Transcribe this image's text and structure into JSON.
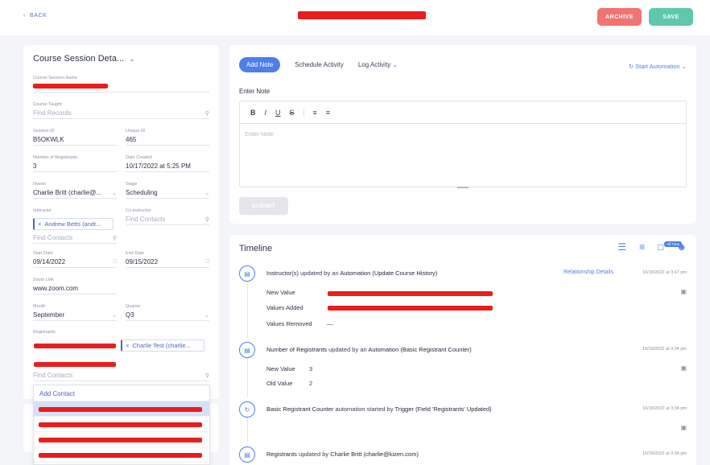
{
  "header": {
    "back_label": "BACK",
    "archive_label": "ARCHIVE",
    "save_label": "SAVE",
    "colors": {
      "archive": "#f07470",
      "save": "#5fc7ad",
      "accent": "#4d7fea"
    }
  },
  "left_panel": {
    "title": "Course Session Deta...",
    "fields": {
      "session_name": {
        "label": "Course Session Name"
      },
      "course_taught": {
        "label": "Course Taught",
        "placeholder": "Find Records"
      },
      "session_id": {
        "label": "Session ID",
        "value": "B5OKWLK"
      },
      "unique_id": {
        "label": "Unique ID",
        "value": "465"
      },
      "num_registrants": {
        "label": "Number of Registrants",
        "value": "3"
      },
      "date_created": {
        "label": "Date Created",
        "value": "10/17/2022 at 5:25 PM"
      },
      "owner": {
        "label": "Owner",
        "value": "Charlie Britt (charlie@..."
      },
      "stage": {
        "label": "Stage",
        "value": "Scheduling"
      },
      "instructor": {
        "label": "Instructor",
        "chip": "Andrew Betts (andr...",
        "placeholder": "Find Contacts"
      },
      "co_instructor": {
        "label": "Co-instructor",
        "placeholder": "Find Contacts"
      },
      "start_date": {
        "label": "Start Date",
        "value": "09/14/2022"
      },
      "end_date": {
        "label": "End Date",
        "value": "09/15/2022"
      },
      "zoom_link": {
        "label": "Zoom Link",
        "value": "www.zoom.com"
      },
      "month": {
        "label": "Month",
        "value": "September"
      },
      "quarter": {
        "label": "Quarter",
        "value": "Q3"
      },
      "registrants": {
        "label": "Registrants",
        "chip": "Charlie Test (charlie...",
        "placeholder": "Find Contacts"
      }
    },
    "dropdown": {
      "add_label": "Add Contact"
    }
  },
  "note_panel": {
    "tabs": [
      "Add Note",
      "Schedule Activity",
      "Log Activity"
    ],
    "start_automation": "Start Automation",
    "enter_note_label": "Enter Note",
    "editor_placeholder": "Enter Note",
    "toolbar": {
      "bold": "B",
      "italic": "I",
      "underline": "U",
      "strike": "S"
    },
    "submit_label": "SUBMIT"
  },
  "timeline": {
    "title": "Timeline",
    "filter_badge": "All Time",
    "events": [
      {
        "subject": "Instructor(s)",
        "verb": " updated by an ",
        "actor": "Automation (Update Course History)",
        "link": "Relationship Details",
        "time": "10/19/2022 at 3:47 pm",
        "rows": [
          {
            "key": "New Value",
            "value": ""
          },
          {
            "key": "Values Added",
            "value": ""
          },
          {
            "key": "Values Removed",
            "value": "—"
          }
        ]
      },
      {
        "subject": "Number of Registrants",
        "verb": " updated by an ",
        "actor": "Automation (Basic Registrant Counter)",
        "time": "10/19/2022 at 3:34 pm",
        "rows": [
          {
            "key": "New Value",
            "value": "3"
          },
          {
            "key": "Old Value",
            "value": "2"
          }
        ]
      },
      {
        "subject": "Basic Registrant Counter",
        "verb": " automation started by ",
        "actor": "Trigger (Field 'Registrants' Updated)",
        "time": "10/19/2022 at 3:34 pm"
      },
      {
        "subject": "Registrants",
        "verb": " updated by ",
        "actor": "Charlie Britt (charlie@kizen.com)",
        "time": "10/19/2022 at 3:34 pm"
      }
    ]
  }
}
